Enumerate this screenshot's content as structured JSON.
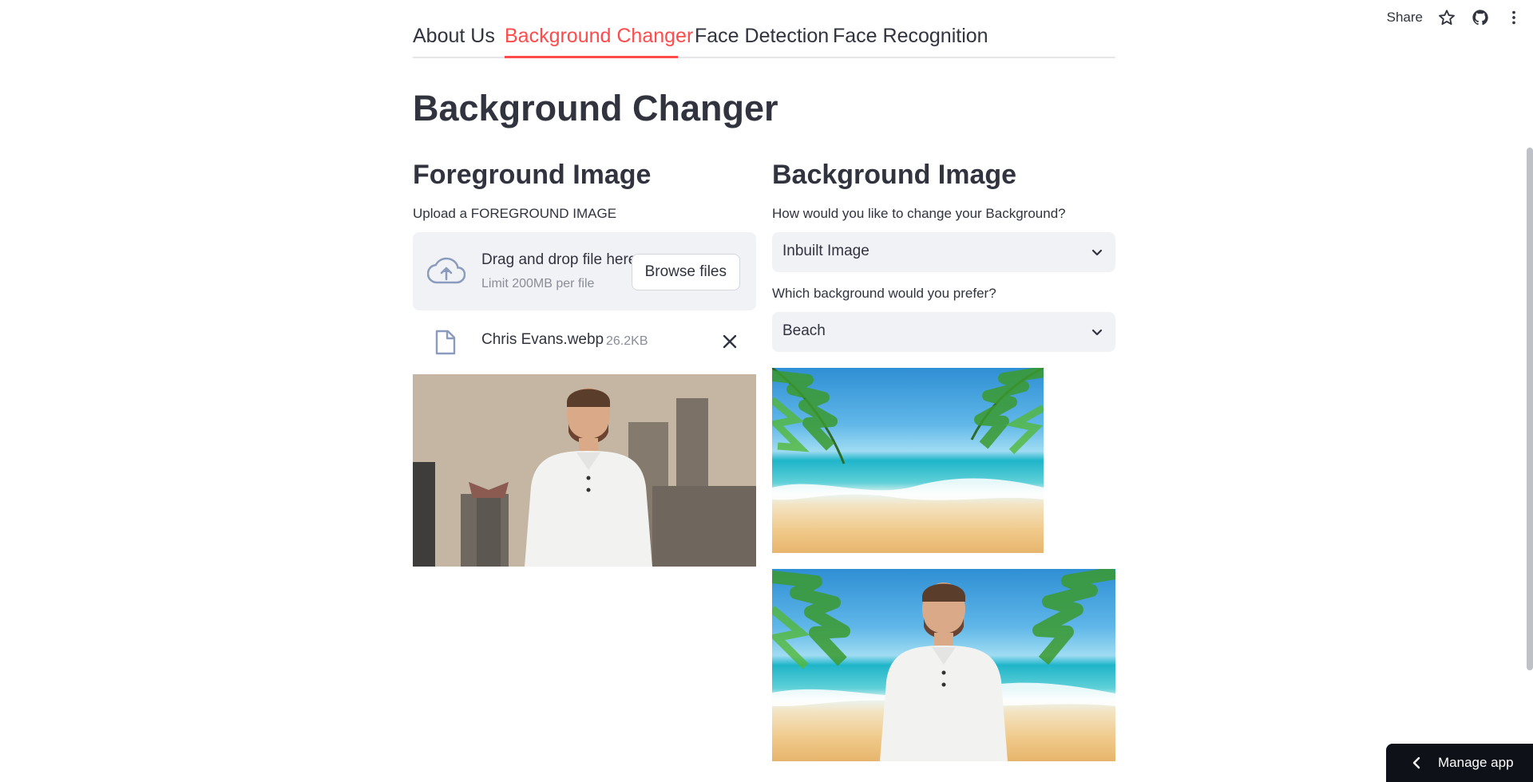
{
  "toolbar": {
    "share_label": "Share"
  },
  "tabs": [
    {
      "label": "About Us",
      "active": false
    },
    {
      "label": "Background Changer",
      "active": true
    },
    {
      "label": "Face Detection",
      "active": false
    },
    {
      "label": "Face Recognition",
      "active": false
    }
  ],
  "page": {
    "title": "Background Changer"
  },
  "foreground": {
    "heading": "Foreground Image",
    "upload_label": "Upload a FOREGROUND IMAGE",
    "dropzone_text": "Drag and drop file here",
    "dropzone_limit": "Limit 200MB per file",
    "browse_label": "Browse files",
    "file_name": "Chris Evans.webp",
    "file_size": "26.2KB"
  },
  "background": {
    "heading": "Background Image",
    "change_label": "How would you like to change your Background?",
    "change_value": "Inbuilt Image",
    "prefer_label": "Which background would you prefer?",
    "prefer_value": "Beach"
  },
  "manage_app": {
    "label": "Manage app"
  },
  "colors": {
    "accent": "#ff4b4b",
    "text": "#31333f",
    "widget_bg": "#f0f2f6",
    "manage_bg": "#0e1117"
  },
  "icons": [
    "star-icon",
    "github-icon",
    "more-vertical-icon",
    "cloud-upload-icon",
    "file-icon",
    "close-icon",
    "chevron-down-icon",
    "chevron-left-icon"
  ]
}
